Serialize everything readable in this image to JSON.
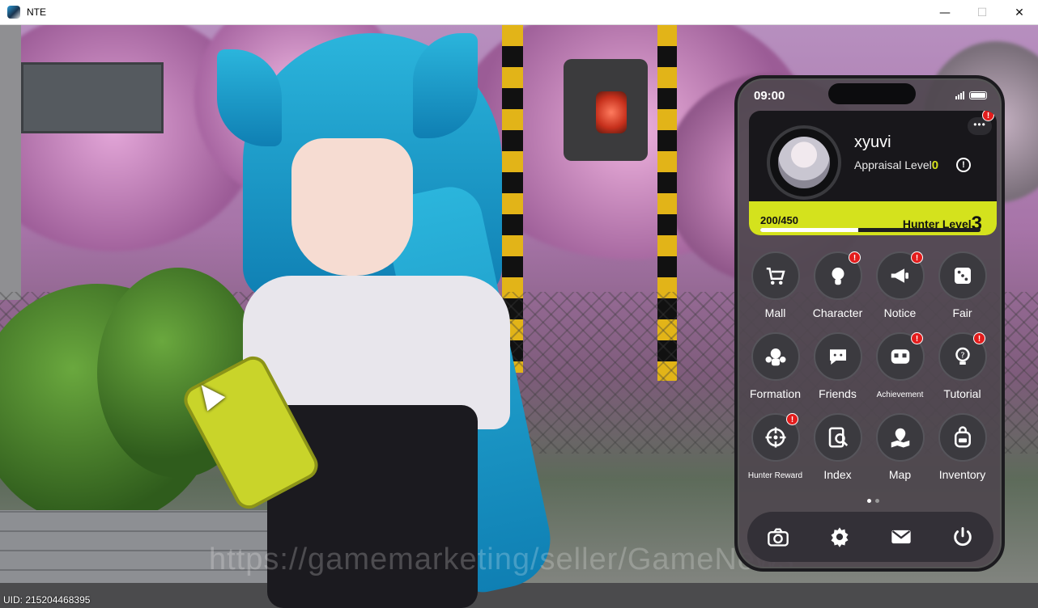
{
  "window": {
    "title": "NTE",
    "minimize": "—",
    "maximize": "☐",
    "close": "✕"
  },
  "scene": {
    "watermark": "https://gamemarketing/seller/GameNews",
    "uid": "UID: 215204468395"
  },
  "phone": {
    "time": "09:00",
    "profile": {
      "name": "xyuvi",
      "appraisal_label": "Appraisal Level",
      "appraisal_level": "0",
      "more": "•••",
      "info": "!",
      "exp": "200/450",
      "exp_fraction": 0.444,
      "hunter_label": "Hunter Level",
      "hunter_level": "3",
      "has_alert": true
    },
    "apps": [
      {
        "label": "Mall",
        "icon": "cart-icon",
        "alert": false
      },
      {
        "label": "Character",
        "icon": "character-icon",
        "alert": true
      },
      {
        "label": "Notice",
        "icon": "megaphone-icon",
        "alert": true
      },
      {
        "label": "Fair",
        "icon": "dice-icon",
        "alert": false
      },
      {
        "label": "Formation",
        "icon": "formation-icon",
        "alert": false
      },
      {
        "label": "Friends",
        "icon": "chat-icon",
        "alert": false
      },
      {
        "label": "Achievement",
        "icon": "achievement-icon",
        "alert": true
      },
      {
        "label": "Tutorial",
        "icon": "lightbulb-icon",
        "alert": true
      },
      {
        "label": "Hunter Reward",
        "icon": "target-icon",
        "alert": true
      },
      {
        "label": "Index",
        "icon": "index-icon",
        "alert": false
      },
      {
        "label": "Map",
        "icon": "map-icon",
        "alert": false
      },
      {
        "label": "Inventory",
        "icon": "backpack-icon",
        "alert": false
      }
    ],
    "page": {
      "current": 1,
      "total": 2
    },
    "dock": [
      "camera-icon",
      "settings-gear-icon",
      "mail-icon",
      "power-icon"
    ],
    "badge_symbol": "!",
    "colors": {
      "accent": "#d4e21d",
      "alert": "#e31c1c"
    }
  }
}
